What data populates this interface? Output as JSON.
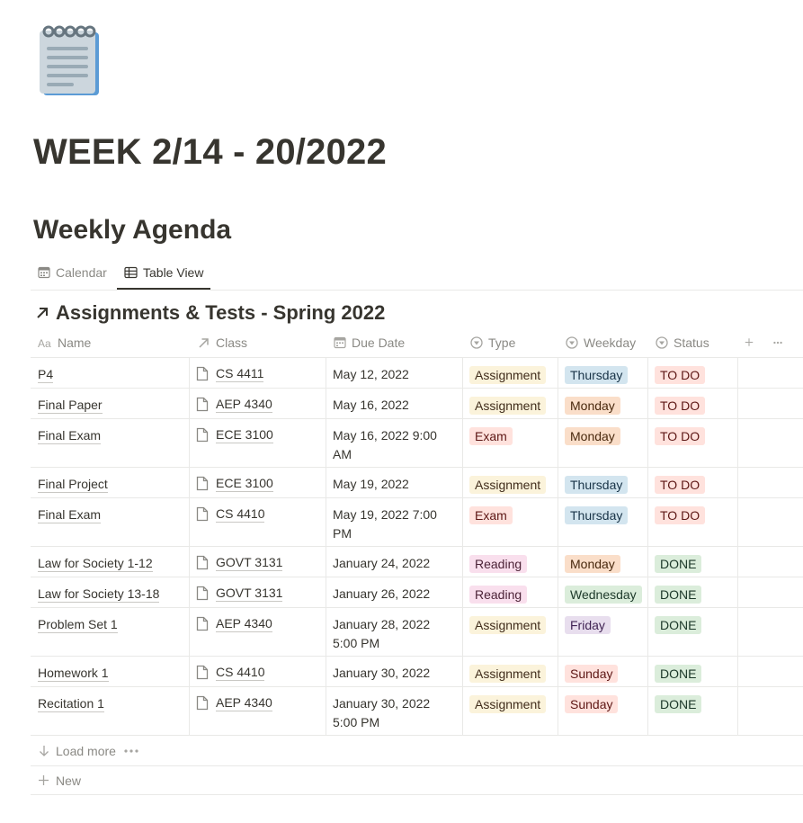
{
  "page": {
    "icon": "spiral-notepad-icon",
    "title": "WEEK 2/14 - 20/2022"
  },
  "section": {
    "heading": "Weekly Agenda"
  },
  "views": [
    {
      "label": "Calendar",
      "icon": "calendar-icon",
      "active": false
    },
    {
      "label": "Table View",
      "icon": "table-icon",
      "active": true
    }
  ],
  "database": {
    "title": "Assignments & Tests - Spring 2022",
    "title_icon": "linked-arrow-icon"
  },
  "columns": {
    "name": "Name",
    "class": "Class",
    "due_date": "Due Date",
    "type": "Type",
    "weekday": "Weekday",
    "status": "Status"
  },
  "rows": [
    {
      "name": "P4",
      "class": "CS 4411",
      "due_date": "May 12, 2022",
      "type": "Assignment",
      "weekday": "Thursday",
      "status": "TO DO"
    },
    {
      "name": "Final Paper",
      "class": "AEP 4340",
      "due_date": "May 16, 2022",
      "type": "Assignment",
      "weekday": "Monday",
      "status": "TO DO"
    },
    {
      "name": "Final Exam",
      "class": "ECE 3100",
      "due_date": "May 16, 2022 9:00 AM",
      "type": "Exam",
      "weekday": "Monday",
      "status": "TO DO"
    },
    {
      "name": "Final Project",
      "class": "ECE 3100",
      "due_date": "May 19, 2022",
      "type": "Assignment",
      "weekday": "Thursday",
      "status": "TO DO"
    },
    {
      "name": "Final Exam",
      "class": "CS 4410",
      "due_date": "May 19, 2022 7:00 PM",
      "type": "Exam",
      "weekday": "Thursday",
      "status": "TO DO"
    },
    {
      "name": "Law for Society 1-12",
      "class": "GOVT 3131",
      "due_date": "January 24, 2022",
      "type": "Reading",
      "weekday": "Monday",
      "status": "DONE"
    },
    {
      "name": "Law for Society 13-18",
      "class": "GOVT 3131",
      "due_date": "January 26, 2022",
      "type": "Reading",
      "weekday": "Wednesday",
      "status": "DONE"
    },
    {
      "name": "Problem Set 1",
      "class": "AEP 4340",
      "due_date": "January 28, 2022 5:00 PM",
      "type": "Assignment",
      "weekday": "Friday",
      "status": "DONE"
    },
    {
      "name": "Homework 1",
      "class": "CS 4410",
      "due_date": "January 30, 2022",
      "type": "Assignment",
      "weekday": "Sunday",
      "status": "DONE"
    },
    {
      "name": "Recitation 1",
      "class": "AEP 4340",
      "due_date": "January 30, 2022 5:00 PM",
      "type": "Assignment",
      "weekday": "Sunday",
      "status": "DONE"
    }
  ],
  "tag_colors": {
    "Assignment": {
      "bg": "#fbf3db",
      "fg": "#402c1b"
    },
    "Exam": {
      "bg": "#ffe2dd",
      "fg": "#5d1715"
    },
    "Reading": {
      "bg": "#f9dfed",
      "fg": "#4c2337"
    },
    "Monday": {
      "bg": "#fadec9",
      "fg": "#49290e"
    },
    "Thursday": {
      "bg": "#d3e5ef",
      "fg": "#183347"
    },
    "Wednesday": {
      "bg": "#dbeddb",
      "fg": "#1c3829"
    },
    "Friday": {
      "bg": "#e8deee",
      "fg": "#412454"
    },
    "Sunday": {
      "bg": "#ffe2dd",
      "fg": "#5d1715"
    },
    "TO DO": {
      "bg": "#ffe2dd",
      "fg": "#5d1715"
    },
    "DONE": {
      "bg": "#dbeddb",
      "fg": "#1c3829"
    }
  },
  "footer": {
    "load_more": "Load more",
    "new": "New"
  }
}
